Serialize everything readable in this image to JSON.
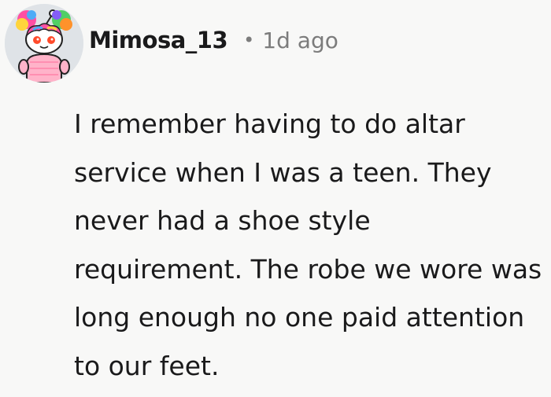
{
  "comment": {
    "author": "Mimosa_13",
    "separator": "•",
    "timestamp": "1d ago",
    "avatar_icon": "reddit-snoo-avatar-icon",
    "body": "I remember having to do altar service when I was a teen. They never had a shoe style requirement. The robe we wore was long enough no one paid attention to our feet."
  },
  "colors": {
    "background": "#f8f8f7",
    "text": "#1a1a1b",
    "meta_text": "#7c7c7c"
  }
}
